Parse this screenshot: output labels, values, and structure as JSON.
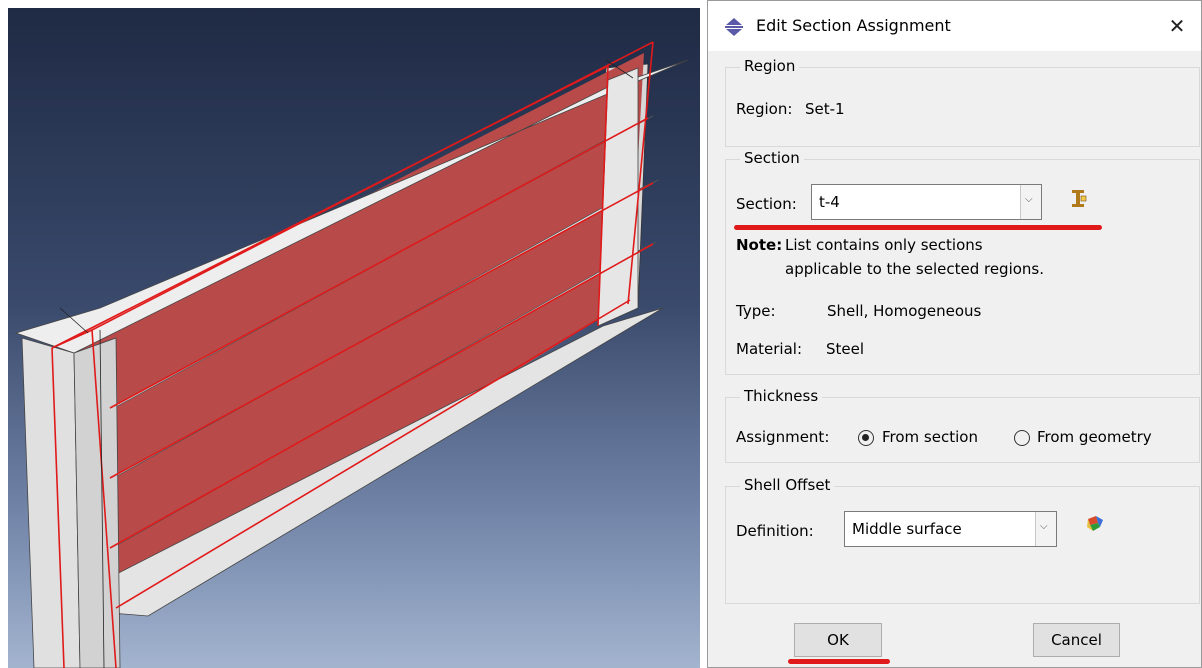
{
  "dialog": {
    "title": "Edit Section Assignment",
    "close_glyph": "✕",
    "region": {
      "legend": "Region",
      "label": "Region:",
      "value": "Set-1"
    },
    "section": {
      "legend": "Section",
      "label": "Section:",
      "selected": "t-4",
      "note_label": "Note:",
      "note_line1": "List contains only sections",
      "note_line2": "applicable to the selected regions.",
      "type_label": "Type:",
      "type_value": "Shell, Homogeneous",
      "material_label": "Material:",
      "material_value": "Steel"
    },
    "thickness": {
      "legend": "Thickness",
      "label": "Assignment:",
      "option_section": "From section",
      "option_geometry": "From geometry",
      "selected": "From section"
    },
    "shell_offset": {
      "legend": "Shell Offset",
      "label": "Definition:",
      "selected": "Middle surface"
    },
    "buttons": {
      "ok": "OK",
      "cancel": "Cancel"
    }
  },
  "icons": [
    "section-manager-icon",
    "shell-offset-icon",
    "app-title-icon",
    "close-icon",
    "chevron-down-icon"
  ],
  "colors": {
    "highlight_red": "#e01a1a",
    "assigned_region": "#b84a4a",
    "plate": "#ebebeb"
  }
}
